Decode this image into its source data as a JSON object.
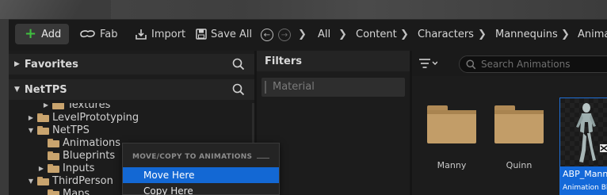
{
  "toolbar": {
    "add_label": "Add",
    "fab_label": "Fab",
    "import_label": "Import",
    "save_all_label": "Save All",
    "breadcrumbs": [
      "All",
      "Content",
      "Characters",
      "Mannequins",
      "Animat"
    ]
  },
  "left_panel": {
    "favorites_label": "Favorites",
    "project_label": "NetTPS",
    "tree": [
      {
        "label": "Textures",
        "expander": "collapsed",
        "open": false
      },
      {
        "label": "LevelPrototyping",
        "expander": "collapsed",
        "open": false
      },
      {
        "label": "NetTPS",
        "expander": "expanded",
        "open": true
      },
      {
        "label": "Animations",
        "expander": "none",
        "open": false
      },
      {
        "label": "Blueprints",
        "expander": "none",
        "open": false
      },
      {
        "label": "Inputs",
        "expander": "collapsed",
        "open": false
      },
      {
        "label": "ThirdPerson",
        "expander": "expanded",
        "open": true
      },
      {
        "label": "Maps",
        "expander": "none",
        "open": false
      }
    ]
  },
  "filters": {
    "header": "Filters",
    "items": [
      "Material"
    ]
  },
  "content": {
    "search_placeholder": "Search Animations",
    "assets": [
      {
        "name": "Manny",
        "kind": "folder"
      },
      {
        "name": "Quinn",
        "kind": "folder"
      },
      {
        "name": "ABP_Manny",
        "kind": "animation-blueprint",
        "subtitle": "Animation Blue...",
        "selected": true
      }
    ]
  },
  "context_menu": {
    "title": "MOVE/COPY TO ANIMATIONS",
    "items": [
      {
        "label": "Move Here",
        "highlighted": true
      },
      {
        "label": "Copy Here",
        "highlighted": false
      }
    ]
  },
  "colors": {
    "accent_blue": "#1368d4",
    "add_plus_green": "#3fbf3f",
    "folder_tan": "#c29d68"
  }
}
